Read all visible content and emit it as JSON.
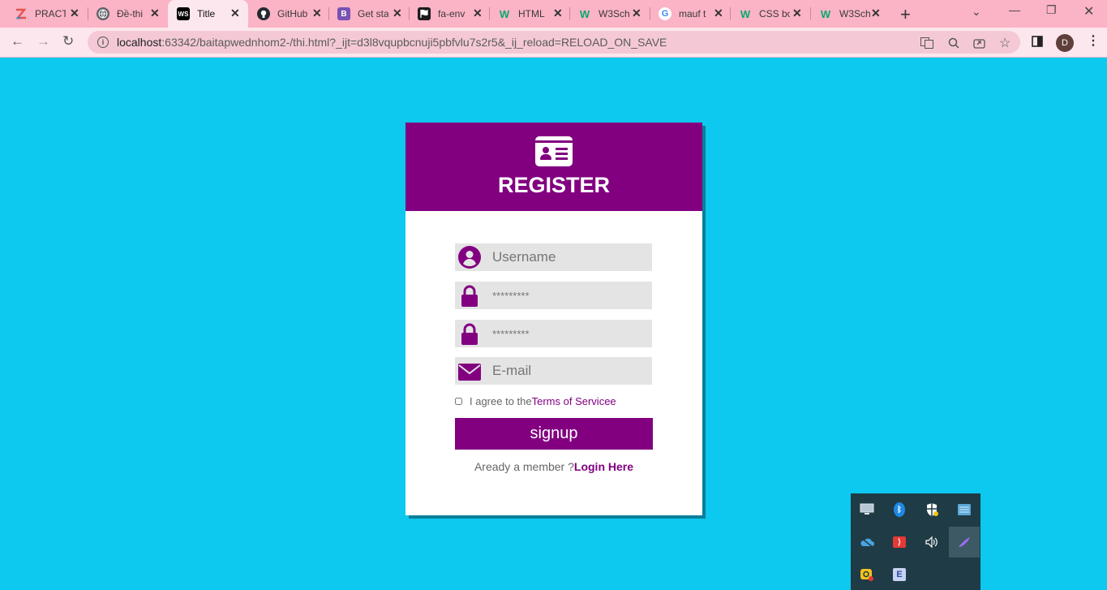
{
  "browser": {
    "tabs": [
      {
        "title": "PRACT",
        "favicon": "zoho-icon",
        "color": "#e2534a"
      },
      {
        "title": "Đề-thi",
        "favicon": "globe-icon",
        "color": "#5f6368"
      },
      {
        "title": "Title",
        "favicon": "webstorm-icon",
        "color": "#000000",
        "active": true
      },
      {
        "title": "GitHub",
        "favicon": "github-icon",
        "color": "#24292f"
      },
      {
        "title": "Get sta",
        "favicon": "bootstrap-icon",
        "color": "#7952b3"
      },
      {
        "title": "fa-env",
        "favicon": "fontawesome-flag-icon",
        "color": "#1b1b1b"
      },
      {
        "title": "HTML",
        "favicon": "w3schools-icon",
        "color": "#04aa6d"
      },
      {
        "title": "W3Sch",
        "favicon": "w3schools-icon",
        "color": "#04aa6d"
      },
      {
        "title": "mauf t",
        "favicon": "google-icon",
        "color": "#4285f4"
      },
      {
        "title": "CSS bo",
        "favicon": "w3schools-icon",
        "color": "#04aa6d"
      },
      {
        "title": "W3Sch",
        "favicon": "w3schools-icon",
        "color": "#04aa6d"
      }
    ],
    "url_host": "localhost",
    "url_path": ":63342/baitapwednhom2-/thi.html?_ijt=d3l8vqupbcnuji5pbfvlu7s2r5&_ij_reload=RELOAD_ON_SAVE",
    "profile_initial": "D"
  },
  "register": {
    "title": "REGISTER",
    "username_placeholder": "Username",
    "password_placeholder": "*********",
    "confirm_placeholder": "*********",
    "email_placeholder": "E-mail",
    "agree_text": "I agree to the",
    "terms_link": "Terms of Servicee",
    "signup_label": "signup",
    "member_text": "Aready a member ?",
    "login_link": "Login Here"
  },
  "colors": {
    "page_bg": "#0dc8ef",
    "accent": "#820080",
    "field_bg": "#e4e4e4"
  },
  "tray": {
    "items": [
      "display-icon",
      "bluetooth-icon",
      "security-icon",
      "network-icon",
      "onedrive-icon",
      "record-icon",
      "volume-icon",
      "pen-icon",
      "vpn-icon",
      "app-icon"
    ]
  }
}
